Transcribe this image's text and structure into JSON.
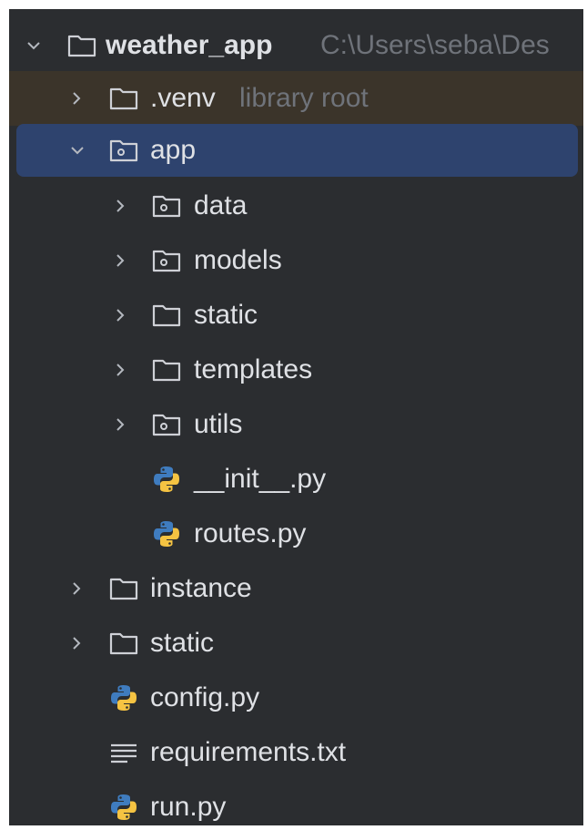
{
  "project": {
    "name": "weather_app",
    "path": "C:\\Users\\seba\\Des",
    "expanded": true
  },
  "tree": [
    {
      "label": ".venv",
      "hint": "library root",
      "type": "folder",
      "expanded": false
    },
    {
      "label": "app",
      "type": "package",
      "expanded": true,
      "selected": true
    },
    {
      "label": "data",
      "type": "package",
      "expanded": false
    },
    {
      "label": "models",
      "type": "package",
      "expanded": false
    },
    {
      "label": "static",
      "type": "folder",
      "expanded": false
    },
    {
      "label": "templates",
      "type": "folder",
      "expanded": false
    },
    {
      "label": "utils",
      "type": "package",
      "expanded": false
    },
    {
      "label": "__init__.py",
      "type": "python-file"
    },
    {
      "label": "routes.py",
      "type": "python-file"
    },
    {
      "label": "instance",
      "type": "folder",
      "expanded": false
    },
    {
      "label": "static",
      "type": "folder",
      "expanded": false
    },
    {
      "label": "config.py",
      "type": "python-file"
    },
    {
      "label": "requirements.txt",
      "type": "text-file"
    },
    {
      "label": "run.py",
      "type": "python-file"
    }
  ],
  "colors": {
    "panel_bg": "#2b2d30",
    "selection": "#2e436e",
    "venv_highlight": "#3b342a",
    "text": "#dfe1e5",
    "hint_text": "#6f737a",
    "python_blue": "#3f7cbf",
    "python_yellow": "#f5c342"
  }
}
